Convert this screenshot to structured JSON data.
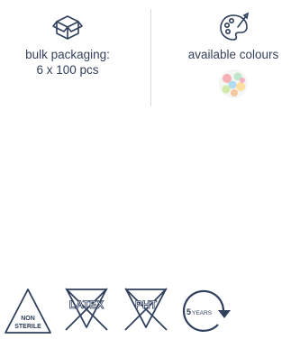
{
  "features": {
    "bulk": {
      "icon": "box-icon",
      "line1": "bulk packaging:",
      "line2": "6 x 100 pcs"
    },
    "colours": {
      "icon": "palette-icon",
      "label": "available colours",
      "swatch_icon": "colour-dots-icon"
    }
  },
  "symbols": {
    "non_sterile": {
      "icon": "non-sterile-triangle-icon",
      "line1": "NON",
      "line2": "STERILE"
    },
    "latex": {
      "icon": "latex-free-icon",
      "label": "LATEX"
    },
    "pht": {
      "icon": "pht-free-icon",
      "label": "PHT"
    },
    "shelf_life": {
      "icon": "shelf-life-icon",
      "num": "5",
      "unit": "YEARS"
    }
  },
  "colors": {
    "text": "#33415c",
    "icon": "#2f3f5c",
    "divider": "#d9dde3"
  }
}
